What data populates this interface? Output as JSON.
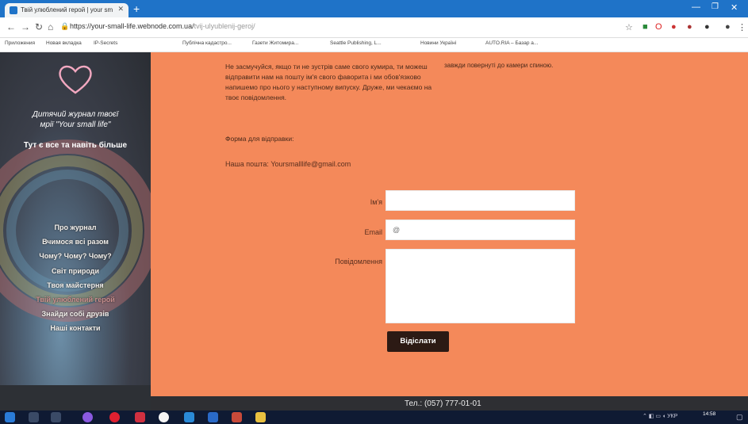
{
  "browser": {
    "tab_title": "Твій улюблений герой | your sm",
    "new_tab_label": "+",
    "url_main": "https://your-small-life.webnode.com.ua/",
    "url_path": "tvij-ulyublenij-geroj/",
    "window_controls": [
      "—",
      "❐",
      "✕"
    ]
  },
  "bookmarks": [
    "Приложения",
    "Новая вкладка",
    "IP-Secrets",
    "Публічна кадастро...",
    "Газети Житомира...",
    "Seattle Publishing, L...",
    "Новини Україні",
    "AUTO.RIA – Базар а..."
  ],
  "sidebar": {
    "logo_line1": "Дитячий журнал твоєї",
    "logo_line2": "мрії \"Your small life\"",
    "tagline": "Тут є все та навіть більше",
    "menu": [
      {
        "label": "Про журнал",
        "active": false
      },
      {
        "label": "Вчимося всі разом",
        "active": false
      },
      {
        "label": "Чому? Чому? Чому?",
        "active": false
      },
      {
        "label": "Світ природи",
        "active": false
      },
      {
        "label": "Твоя майстерня",
        "active": false
      },
      {
        "label": "Твій улюблений герой",
        "active": true
      },
      {
        "label": "Знайди собі друзів",
        "active": false
      },
      {
        "label": "Наші контакти",
        "active": false
      }
    ]
  },
  "content": {
    "paragraph": "Не засмучуйся, якщо ти не зустрів саме свого кумира, ти можеш відправити нам на пошту ім'я свого фаворита і ми обов'язково напишемо про нього у наступному випуску. Друже, ми чекаємо на твоє повідомлення.",
    "form_intro": "Форма для відправки:",
    "email_line": "Наша пошта: Yoursmalllife@gmail.com",
    "right_text": "завжди повернуті до камери спиною."
  },
  "form": {
    "name_label": "Ім'я",
    "name_value": "",
    "email_label": "Email",
    "email_placeholder": "@",
    "message_label": "Повідомлення",
    "message_value": "",
    "submit_label": "Відіслати"
  },
  "footer": {
    "phone": "Тел.: (057) 777-01-01"
  },
  "taskbar": {
    "lang": "УКР",
    "time": "14:58"
  },
  "colors": {
    "page_bg": "#f4895a",
    "button_bg": "#2c1a14",
    "chrome_blue": "#1f73c8"
  }
}
